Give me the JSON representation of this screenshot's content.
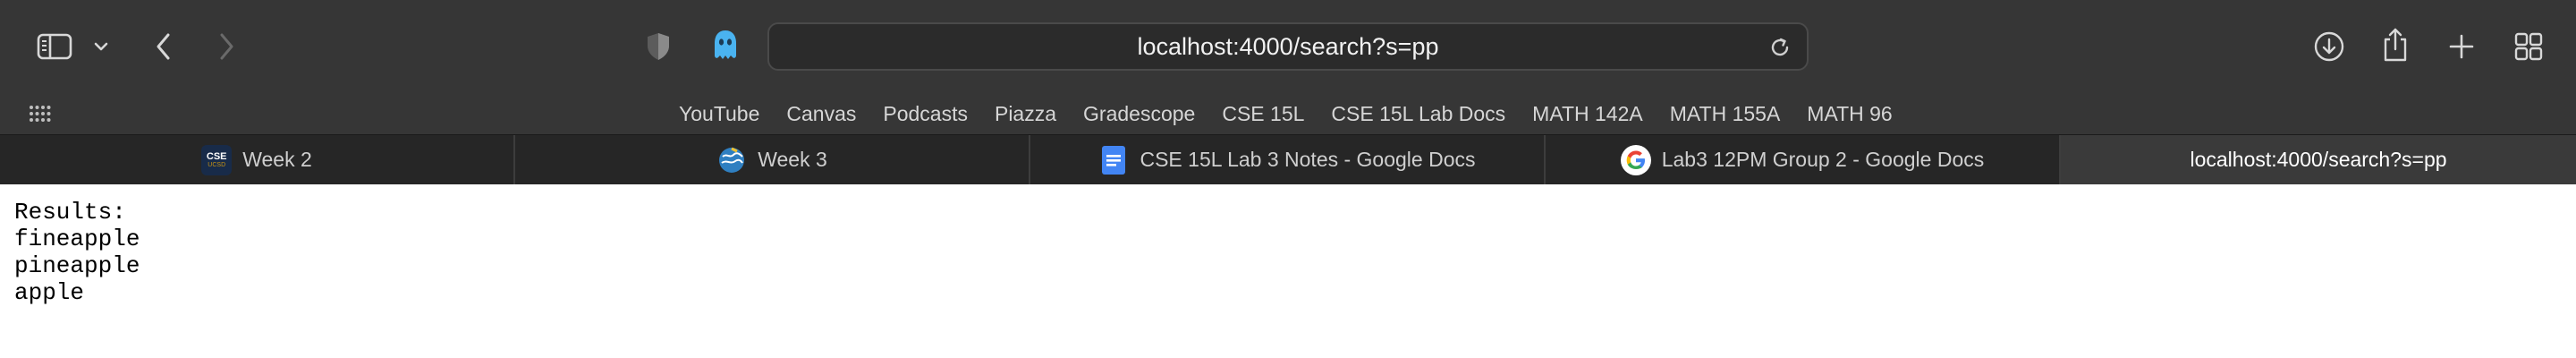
{
  "toolbar": {
    "address": "localhost:4000/search?s=pp"
  },
  "favorites": [
    "YouTube",
    "Canvas",
    "Podcasts",
    "Piazza",
    "Gradescope",
    "CSE 15L",
    "CSE 15L Lab Docs",
    "MATH 142A",
    "MATH 155A",
    "MATH 96"
  ],
  "tabs": [
    {
      "label": "Week 2",
      "icon": "cse-ucsd-favicon",
      "active": false
    },
    {
      "label": "Week 3",
      "icon": "ucsd-globe-favicon",
      "active": false
    },
    {
      "label": "CSE 15L Lab 3 Notes - Google Docs",
      "icon": "google-docs-favicon",
      "active": false
    },
    {
      "label": "Lab3 12PM Group 2 - Google Docs",
      "icon": "google-favicon",
      "active": false
    },
    {
      "label": "localhost:4000/search?s=pp",
      "icon": "",
      "active": true
    }
  ],
  "page": {
    "heading": "Results:",
    "results": [
      "fineapple",
      "pineapple",
      "apple"
    ]
  },
  "colors": {
    "toolbar_bg": "#363636",
    "tab_active_bg": "#3a3a3a",
    "google_docs_blue": "#4285f4",
    "ghost_blue": "#4ab3f0"
  },
  "icons": {
    "cse_favicon_text_top": "CSE",
    "cse_favicon_text_bottom": "UCSD"
  }
}
